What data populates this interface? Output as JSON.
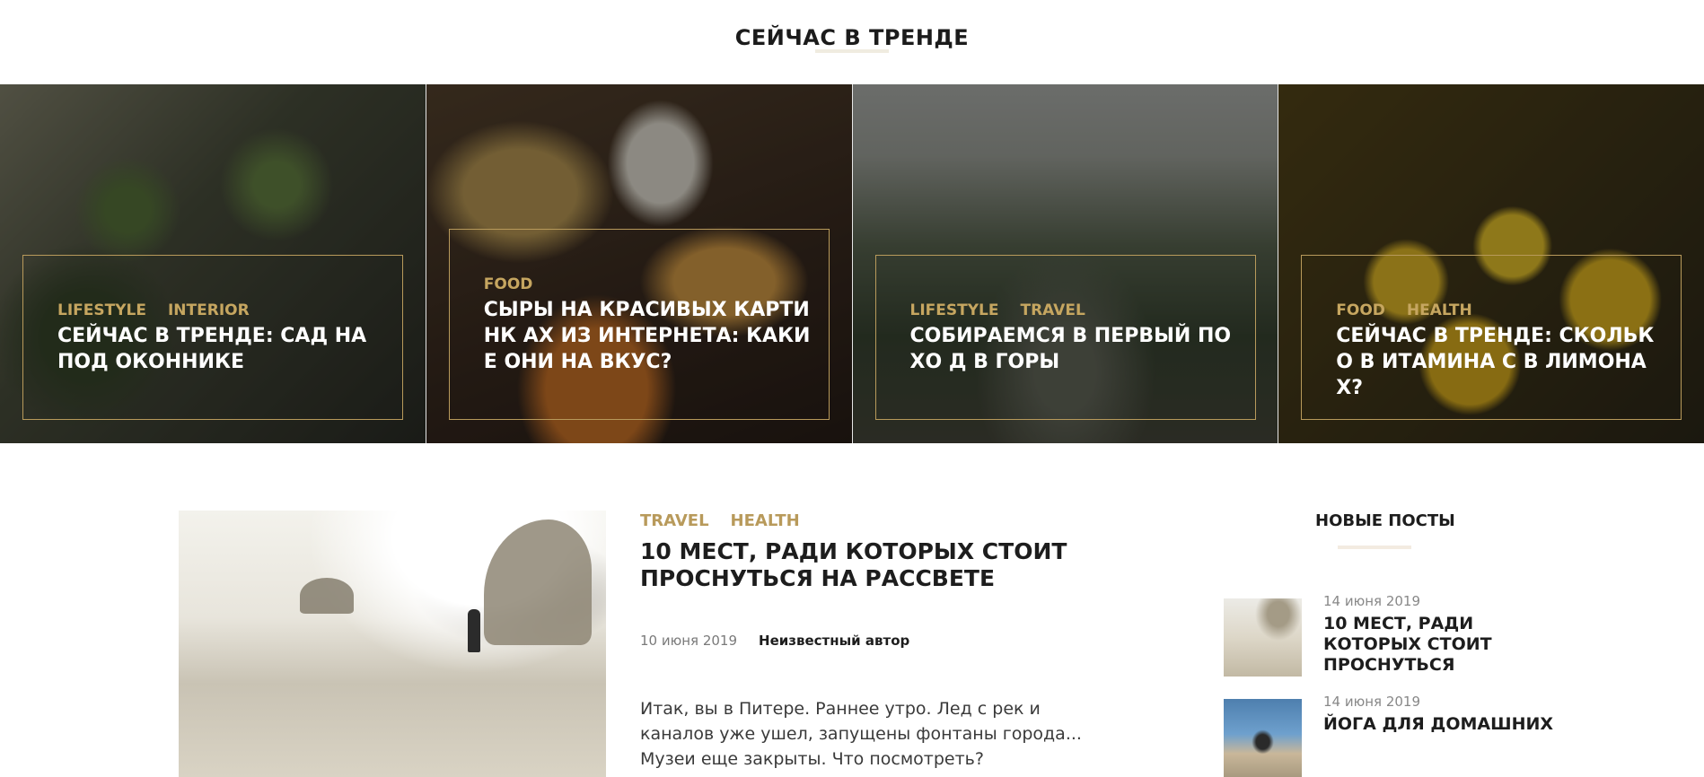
{
  "section": {
    "title": "СЕЙЧАС В ТРЕНДЕ"
  },
  "trending": [
    {
      "categories": [
        "LIFESTYLE",
        "INTERIOR"
      ],
      "title": "СЕЙЧАС В ТРЕНДЕ: САД НА ПОД ОКОННИКЕ",
      "image": "plants-seedlings"
    },
    {
      "categories": [
        "FOOD"
      ],
      "title": "СЫРЫ НА КРАСИВЫХ КАРТИНК АХ ИЗ ИНТЕРНЕТА: КАКИЕ ОНИ НА ВКУС?",
      "image": "cheese-platter"
    },
    {
      "categories": [
        "LIFESTYLE",
        "TRAVEL"
      ],
      "title": "СОБИРАЕМСЯ В ПЕРВЫЙ ПОХО Д В ГОРЫ",
      "image": "mountain-hiker"
    },
    {
      "categories": [
        "FOOD",
        "HEALTH"
      ],
      "title": "СЕЙЧАС В ТРЕНДЕ: СКОЛЬКО В ИТАМИНА С В ЛИМОНАХ?",
      "image": "lemons-crate"
    }
  ],
  "featured": {
    "categories": [
      "TRAVEL",
      "HEALTH"
    ],
    "title": "10 МЕСТ, РАДИ КОТОРЫХ СТОИТ ПРОСНУТЬСЯ НА РАССВЕТЕ",
    "date": "10 июня 2019",
    "author": "Неизвестный автор",
    "excerpt": "Итак, вы в Питере. Раннее утро. Лед с рек и каналов уже ушел, запущены фонтаны города... Музеи еще закрыты. Что посмотреть?"
  },
  "sidebar": {
    "title": "НОВЫЕ ПОСТЫ",
    "posts": [
      {
        "date": "14 июня 2019",
        "title": "10 МЕСТ, РАДИ КОТОРЫХ СТОИТ ПРОСНУТЬСЯ"
      },
      {
        "date": "14 июня 2019",
        "title": "ЙОГА ДЛЯ ДОМАШНИХ"
      }
    ]
  },
  "colors": {
    "accent": "#b89a5b",
    "title": "#1d1d1d",
    "overlay": "#000000"
  }
}
